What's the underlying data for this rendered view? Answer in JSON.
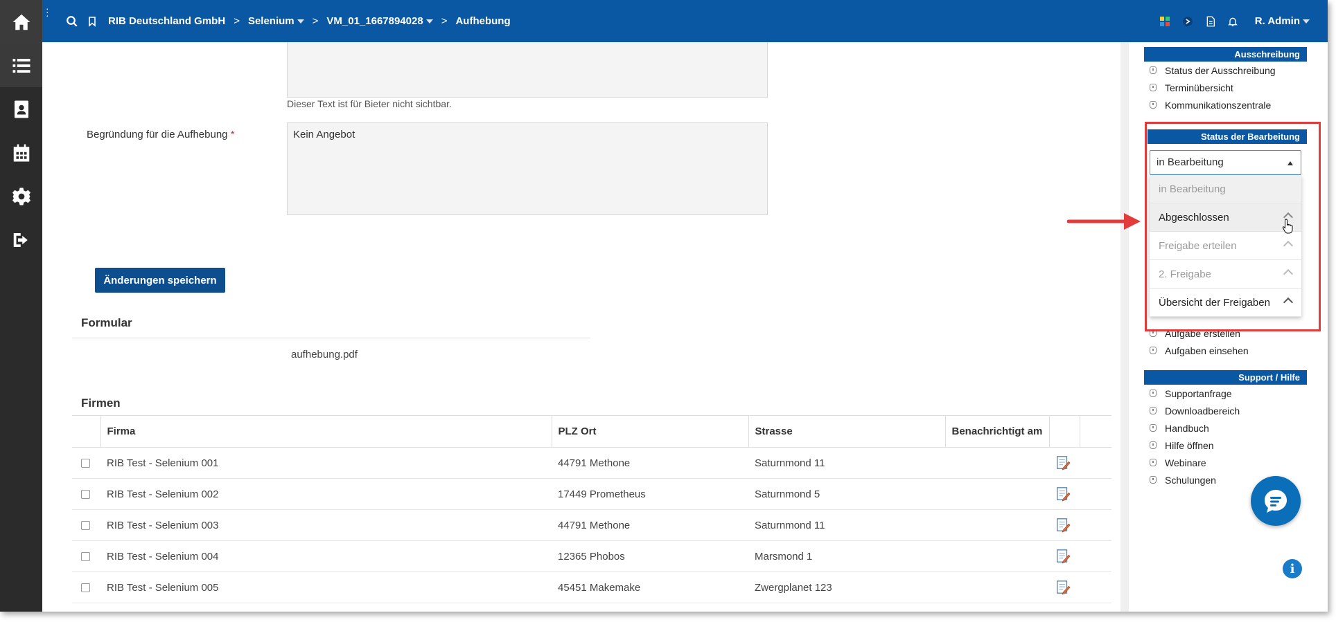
{
  "breadcrumb": {
    "company": "RIB Deutschland GmbH",
    "project": "Selenium",
    "tender": "VM_01_1667894028",
    "page": "Aufhebung"
  },
  "user": {
    "name": "R. Admin"
  },
  "form": {
    "hint": "Dieser Text ist für Bieter nicht sichtbar.",
    "reason_label": "Begründung für die Aufhebung",
    "required_mark": "*",
    "reason_value": "Kein Angebot",
    "save_label": "Änderungen speichern"
  },
  "formular": {
    "title": "Formular",
    "file": "aufhebung.pdf"
  },
  "firms": {
    "title": "Firmen",
    "columns": [
      "Firma",
      "PLZ Ort",
      "Strasse",
      "Benachrichtigt am"
    ],
    "rows": [
      {
        "firma": "RIB Test - Selenium 001",
        "ort": "44791 Methone",
        "strasse": "Saturnmond 11",
        "notified": ""
      },
      {
        "firma": "RIB Test - Selenium 002",
        "ort": "17449 Prometheus",
        "strasse": "Saturnmond 5",
        "notified": ""
      },
      {
        "firma": "RIB Test - Selenium 003",
        "ort": "44791 Methone",
        "strasse": "Saturnmond 11",
        "notified": ""
      },
      {
        "firma": "RIB Test - Selenium 004",
        "ort": "12365 Phobos",
        "strasse": "Marsmond 1",
        "notified": ""
      },
      {
        "firma": "RIB Test - Selenium 005",
        "ort": "45451 Makemake",
        "strasse": "Zwergplanet 123",
        "notified": ""
      }
    ]
  },
  "sidebar": {
    "ausschreibung": {
      "title": "Ausschreibung",
      "links": [
        "Status der Ausschreibung",
        "Terminübersicht",
        "Kommunikationszentrale"
      ]
    },
    "status": {
      "title": "Status der Bearbeitung",
      "selected": "in Bearbeitung",
      "options": [
        "in Bearbeitung",
        "Abgeschlossen",
        "Freigabe erteilen",
        "2. Freigabe",
        "Übersicht der Freigaben"
      ]
    },
    "aufgaben": {
      "links": [
        "Aufgabe erstellen",
        "Aufgaben einsehen"
      ]
    },
    "support": {
      "title": "Support / Hilfe",
      "links": [
        "Supportanfrage",
        "Downloadbereich",
        "Handbuch",
        "Hilfe öffnen",
        "Webinare",
        "Schulungen"
      ]
    }
  },
  "colors": {
    "brand": "#0a57a4",
    "highlight": "#e23b3b",
    "sidebar": "#2b2b2b"
  }
}
